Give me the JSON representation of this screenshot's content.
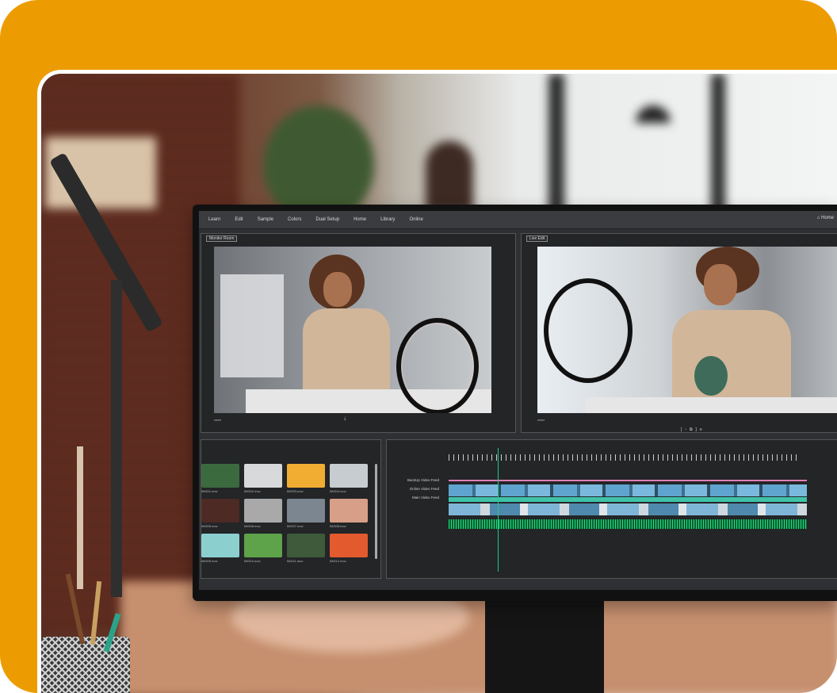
{
  "editor": {
    "menu": [
      "Learn",
      "Edit",
      "Sample",
      "Colors",
      "Dual Setup",
      "Home",
      "Library",
      "Online"
    ],
    "home_label": "Home",
    "monitor_left_tag": "Monitor Room",
    "monitor_right_tag": "Live Edit",
    "timeline_labels": [
      "BackUp Video Feed",
      "Online Video Feed",
      "Main Video Feed"
    ],
    "clip_names": [
      "IMG01.mov",
      "IMG02.mov",
      "IMG03.mov",
      "IMG04.mov",
      "IMG05.mov",
      "IMG06.mov",
      "IMG07.mov",
      "IMG08.mov",
      "IMG09.mov",
      "IMG10.mov",
      "IMG11.mov",
      "IMG12.mov"
    ]
  },
  "colors": {
    "frame": "#ec9c00",
    "track_blue": "#5fa4cf",
    "track_teal": "#3fc3a8",
    "waveform": "#1ee07a",
    "playhead": "#1ec98a",
    "pink_line": "#e07fb6"
  }
}
